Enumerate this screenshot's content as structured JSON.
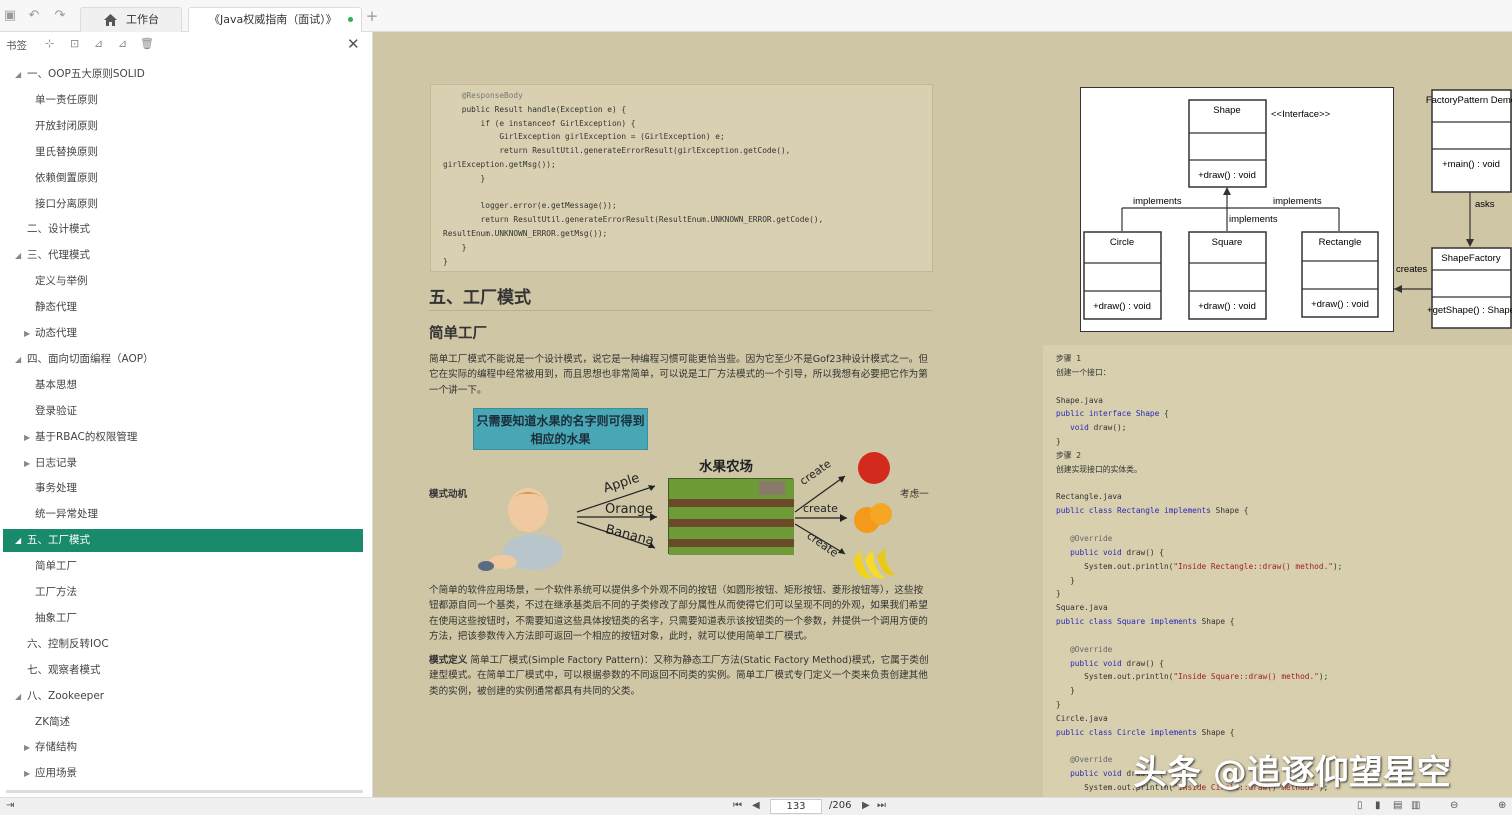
{
  "tabs": {
    "home": "工作台",
    "doc": "《Java权威指南（面试）》"
  },
  "sidebar": {
    "title": "书签",
    "items": [
      {
        "label": "一、OOP五大原则SOLID",
        "level": 0,
        "arrow": "◢"
      },
      {
        "label": "单一责任原则",
        "level": 1,
        "arrow": ""
      },
      {
        "label": "开放封闭原则",
        "level": 1,
        "arrow": ""
      },
      {
        "label": "里氏替换原则",
        "level": 1,
        "arrow": ""
      },
      {
        "label": "依赖倒置原则",
        "level": 1,
        "arrow": ""
      },
      {
        "label": "接口分离原则",
        "level": 1,
        "arrow": ""
      },
      {
        "label": "二、设计模式",
        "level": 0,
        "arrow": ""
      },
      {
        "label": "三、代理模式",
        "level": 0,
        "arrow": "◢"
      },
      {
        "label": "定义与举例",
        "level": 1,
        "arrow": ""
      },
      {
        "label": "静态代理",
        "level": 1,
        "arrow": ""
      },
      {
        "label": "动态代理",
        "level": 1,
        "arrow": "▶"
      },
      {
        "label": "四、面向切面编程（AOP）",
        "level": 0,
        "arrow": "◢"
      },
      {
        "label": "基本思想",
        "level": 1,
        "arrow": ""
      },
      {
        "label": "登录验证",
        "level": 1,
        "arrow": ""
      },
      {
        "label": "基于RBAC的权限管理",
        "level": 1,
        "arrow": "▶"
      },
      {
        "label": "日志记录",
        "level": 1,
        "arrow": "▶"
      },
      {
        "label": "事务处理",
        "level": 1,
        "arrow": ""
      },
      {
        "label": "统一异常处理",
        "level": 1,
        "arrow": ""
      },
      {
        "label": "五、工厂模式",
        "level": 0,
        "arrow": "◢",
        "active": true
      },
      {
        "label": "简单工厂",
        "level": 1,
        "arrow": ""
      },
      {
        "label": "工厂方法",
        "level": 1,
        "arrow": ""
      },
      {
        "label": "抽象工厂",
        "level": 1,
        "arrow": ""
      },
      {
        "label": "六、控制反转IOC",
        "level": 0,
        "arrow": ""
      },
      {
        "label": "七、观察者模式",
        "level": 0,
        "arrow": ""
      },
      {
        "label": "八、Zookeeper",
        "level": 0,
        "arrow": "◢"
      },
      {
        "label": "ZK简述",
        "level": 1,
        "arrow": ""
      },
      {
        "label": "存储结构",
        "level": 1,
        "arrow": "▶"
      },
      {
        "label": "应用场景",
        "level": 1,
        "arrow": "▶"
      }
    ]
  },
  "doc": {
    "code1": [
      "    @ResponseBody",
      "    public Result handle(Exception e) {",
      "        if (e instanceof GirlException) {",
      "            GirlException girlException = (GirlException) e;",
      "            return ResultUtil.generateErrorResult(girlException.getCode(),",
      "girlException.getMsg());",
      "        }",
      "",
      "        logger.error(e.getMessage());",
      "        return ResultUtil.generateErrorResult(ResultEnum.UNKNOWN_ERROR.getCode(),",
      "ResultEnum.UNKNOWN_ERROR.getMsg());",
      "    }",
      "}"
    ],
    "h2": "五、工厂模式",
    "h3": "简单工厂",
    "p1": "简单工厂模式不能说是一个设计模式，说它是一种编程习惯可能更恰当些。因为它至少不是Gof23种设计模式之一。但它在实际的编程中经常被用到，而且思想也非常简单，可以说是工厂方法模式的一个引导，所以我想有必要把它作为第一个讲一下。",
    "banner": "只需要知道水果的名字则可得到相应的水果",
    "motive": "模式动机",
    "farm": "水果农场",
    "apple": "Apple",
    "orange": "Orange",
    "banana": "Banana",
    "create": "create",
    "note": "考虑一",
    "p2": "个简单的软件应用场景，一个软件系统可以提供多个外观不同的按钮（如圆形按钮、矩形按钮、菱形按钮等），这些按钮都源自同一个基类，不过在继承基类后不同的子类修改了部分属性从而使得它们可以呈现不同的外观，如果我们希望在使用这些按钮时，不需要知道这些具体按钮类的名字，只需要知道表示该按钮类的一个参数，并提供一个调用方便的方法，把该参数传入方法即可返回一个相应的按钮对象，此时，就可以使用简单工厂模式。",
    "p3_lead": "模式定义",
    "p3": " 简单工厂模式(Simple Factory Pattern)：又称为静态工厂方法(Static Factory Method)模式，它属于类创建型模式。在简单工厂模式中，可以根据参数的不同返回不同类的实例。简单工厂模式专门定义一个类来负责创建其他类的实例，被创建的实例通常都具有共同的父类。"
  },
  "uml": {
    "shape": "Shape",
    "interface": "<<Interface>>",
    "draw": "+draw() : void",
    "circle": "Circle",
    "square": "Square",
    "rectangle": "Rectangle",
    "implements": "implements",
    "factory_demo": "FactoryPattern Demo",
    "main": "+main() : void",
    "asks": "asks",
    "creates": "creates",
    "shape_factory": "ShapeFactory",
    "get_shape": "+getShape() : Shape"
  },
  "code2": {
    "step1": "步骤 1",
    "step1_desc": "创建一个接口：",
    "shape_java": "Shape.java",
    "step2": "步骤 2",
    "step2_desc": "创建实现接口的实体类。",
    "rect_java": "Rectangle.java",
    "square_java": "Square.java",
    "circle_java": "Circle.java",
    "override": "@Override",
    "inside_rect": "\"Inside Rectangle::draw() method.\"",
    "inside_square": "\"Inside Square::draw() method.\"",
    "inside_circle": "\"Inside Circle::draw() method.\""
  },
  "watermark": "头条 @追逐仰望星空",
  "status": {
    "page": "133",
    "total": "/206"
  }
}
